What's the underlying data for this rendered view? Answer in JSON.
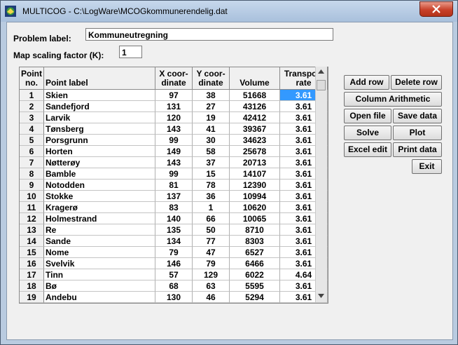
{
  "window": {
    "title": "MULTICOG - C:\\LogWare\\MCOGkommunerendelig.dat"
  },
  "form": {
    "problem_label_caption": "Problem label:",
    "problem_label_value": "Kommuneutregning",
    "scaling_caption": "Map scaling factor (K):",
    "scaling_value": "1"
  },
  "table": {
    "headers": {
      "no": "Point no.",
      "label": "Point label",
      "x": "X coor- dinate",
      "y": "Y coor- dinate",
      "volume": "Volume",
      "rate": "Transport rate"
    },
    "rows": [
      {
        "no": "1",
        "label": "Skien",
        "x": "97",
        "y": "38",
        "volume": "51668",
        "rate": "3.61"
      },
      {
        "no": "2",
        "label": "Sandefjord",
        "x": "131",
        "y": "27",
        "volume": "43126",
        "rate": "3.61"
      },
      {
        "no": "3",
        "label": "Larvik",
        "x": "120",
        "y": "19",
        "volume": "42412",
        "rate": "3.61"
      },
      {
        "no": "4",
        "label": "Tønsberg",
        "x": "143",
        "y": "41",
        "volume": "39367",
        "rate": "3.61"
      },
      {
        "no": "5",
        "label": "Porsgrunn",
        "x": "99",
        "y": "30",
        "volume": "34623",
        "rate": "3.61"
      },
      {
        "no": "6",
        "label": "Horten",
        "x": "149",
        "y": "58",
        "volume": "25678",
        "rate": "3.61"
      },
      {
        "no": "7",
        "label": "Nøtterøy",
        "x": "143",
        "y": "37",
        "volume": "20713",
        "rate": "3.61"
      },
      {
        "no": "8",
        "label": "Bamble",
        "x": "99",
        "y": "15",
        "volume": "14107",
        "rate": "3.61"
      },
      {
        "no": "9",
        "label": "Notodden",
        "x": "81",
        "y": "78",
        "volume": "12390",
        "rate": "3.61"
      },
      {
        "no": "10",
        "label": "Stokke",
        "x": "137",
        "y": "36",
        "volume": "10994",
        "rate": "3.61"
      },
      {
        "no": "11",
        "label": "Kragerø",
        "x": "83",
        "y": "1",
        "volume": "10620",
        "rate": "3.61"
      },
      {
        "no": "12",
        "label": "Holmestrand",
        "x": "140",
        "y": "66",
        "volume": "10065",
        "rate": "3.61"
      },
      {
        "no": "13",
        "label": "Re",
        "x": "135",
        "y": "50",
        "volume": "8710",
        "rate": "3.61"
      },
      {
        "no": "14",
        "label": "Sande",
        "x": "134",
        "y": "77",
        "volume": "8303",
        "rate": "3.61"
      },
      {
        "no": "15",
        "label": "Nome",
        "x": "79",
        "y": "47",
        "volume": "6527",
        "rate": "3.61"
      },
      {
        "no": "16",
        "label": "Svelvik",
        "x": "146",
        "y": "79",
        "volume": "6466",
        "rate": "3.61"
      },
      {
        "no": "17",
        "label": "Tinn",
        "x": "57",
        "y": "129",
        "volume": "6022",
        "rate": "4.64"
      },
      {
        "no": "18",
        "label": "Bø",
        "x": "68",
        "y": "63",
        "volume": "5595",
        "rate": "3.61"
      },
      {
        "no": "19",
        "label": "Andebu",
        "x": "130",
        "y": "46",
        "volume": "5294",
        "rate": "3.61"
      }
    ]
  },
  "buttons": {
    "add_row": "Add row",
    "delete_row": "Delete row",
    "column_arithmetic": "Column Arithmetic",
    "open_file": "Open file",
    "save_data": "Save data",
    "solve": "Solve",
    "plot": "Plot",
    "excel_edit": "Excel edit",
    "print_data": "Print data",
    "exit": "Exit"
  }
}
